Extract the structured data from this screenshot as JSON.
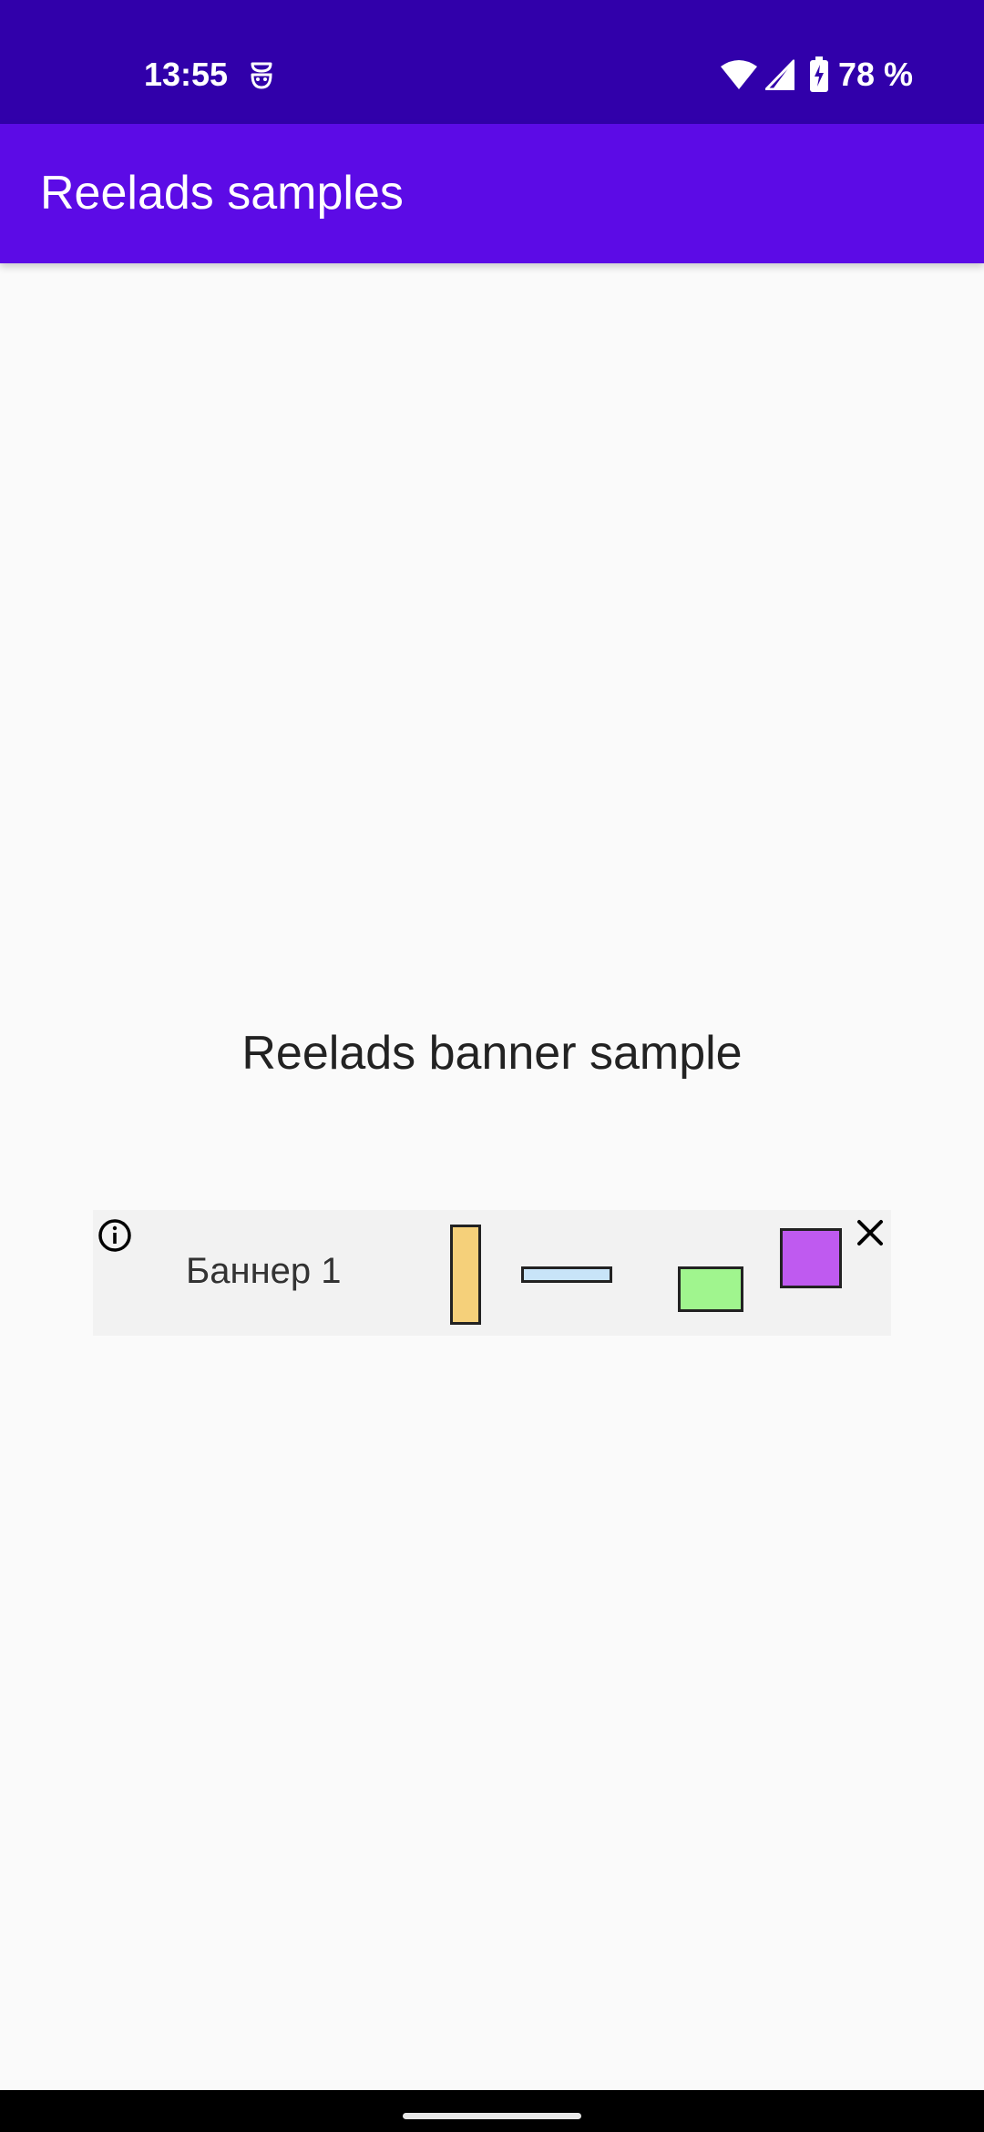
{
  "status_bar": {
    "time": "13:55",
    "battery": "78 %",
    "icons": [
      "face-notification-icon",
      "wifi-icon",
      "signal-icon",
      "battery-charging-icon"
    ]
  },
  "app_bar": {
    "title": "Reelads samples"
  },
  "content": {
    "title": "Reelads banner sample"
  },
  "banner": {
    "text": "Баннер 1",
    "shapes": [
      {
        "name": "yellow-rectangle",
        "color": "#f5d07a"
      },
      {
        "name": "blue-rectangle",
        "color": "#c8e4f8"
      },
      {
        "name": "green-rectangle",
        "color": "#a0f58e"
      },
      {
        "name": "purple-square",
        "color": "#bf5af0"
      }
    ]
  },
  "colors": {
    "status_bar": "#3100aa",
    "app_bar": "#5c0be6",
    "background": "#fafafa",
    "banner_background": "#f2f2f2",
    "nav_bar": "#000000"
  }
}
